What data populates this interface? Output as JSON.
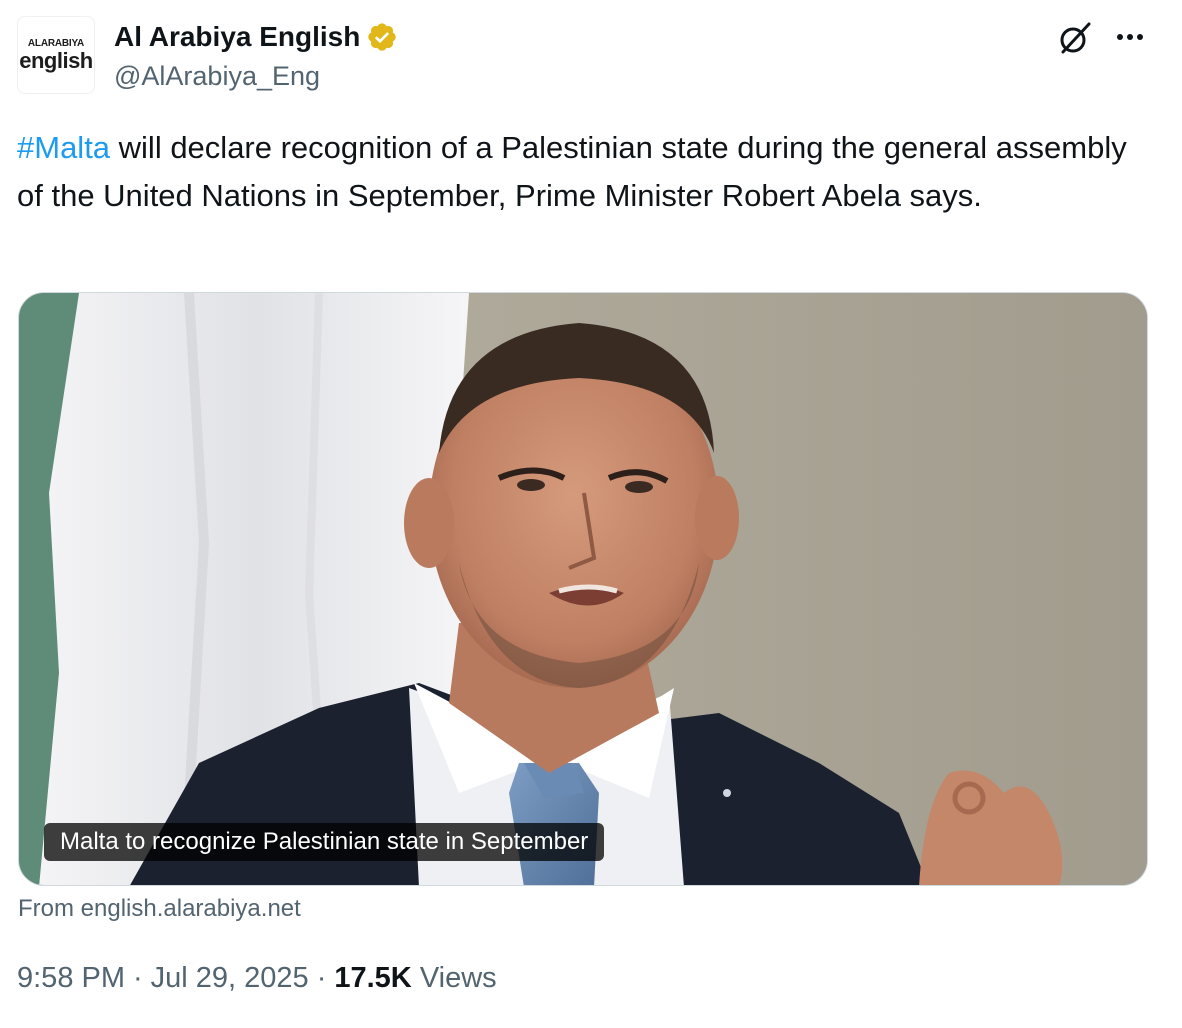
{
  "account": {
    "avatar_line1": "ALARABIYA",
    "avatar_line2": "english",
    "display_name": "Al Arabiya English",
    "handle": "@AlArabiya_Eng",
    "verified_badge_color": "#e2b719"
  },
  "tweet": {
    "hashtag": "#Malta",
    "text": " will declare recognition of a Palestinian state during the general assembly of the United Nations in September, Prime Minister Robert Abela says."
  },
  "media": {
    "caption": "Malta to recognize Palestinian state in September",
    "source": "From english.alarabiya.net"
  },
  "meta": {
    "time": "9:58 PM",
    "separator": "·",
    "date": "Jul 29, 2025",
    "views_count": "17.5K",
    "views_label": "Views"
  },
  "icons": {
    "grok": "grok-icon",
    "more": "more-dots-icon",
    "verified": "verified-badge-icon"
  },
  "colors": {
    "link": "#1d9bf0",
    "secondary_text": "#536471",
    "primary_text": "#0f1419"
  }
}
